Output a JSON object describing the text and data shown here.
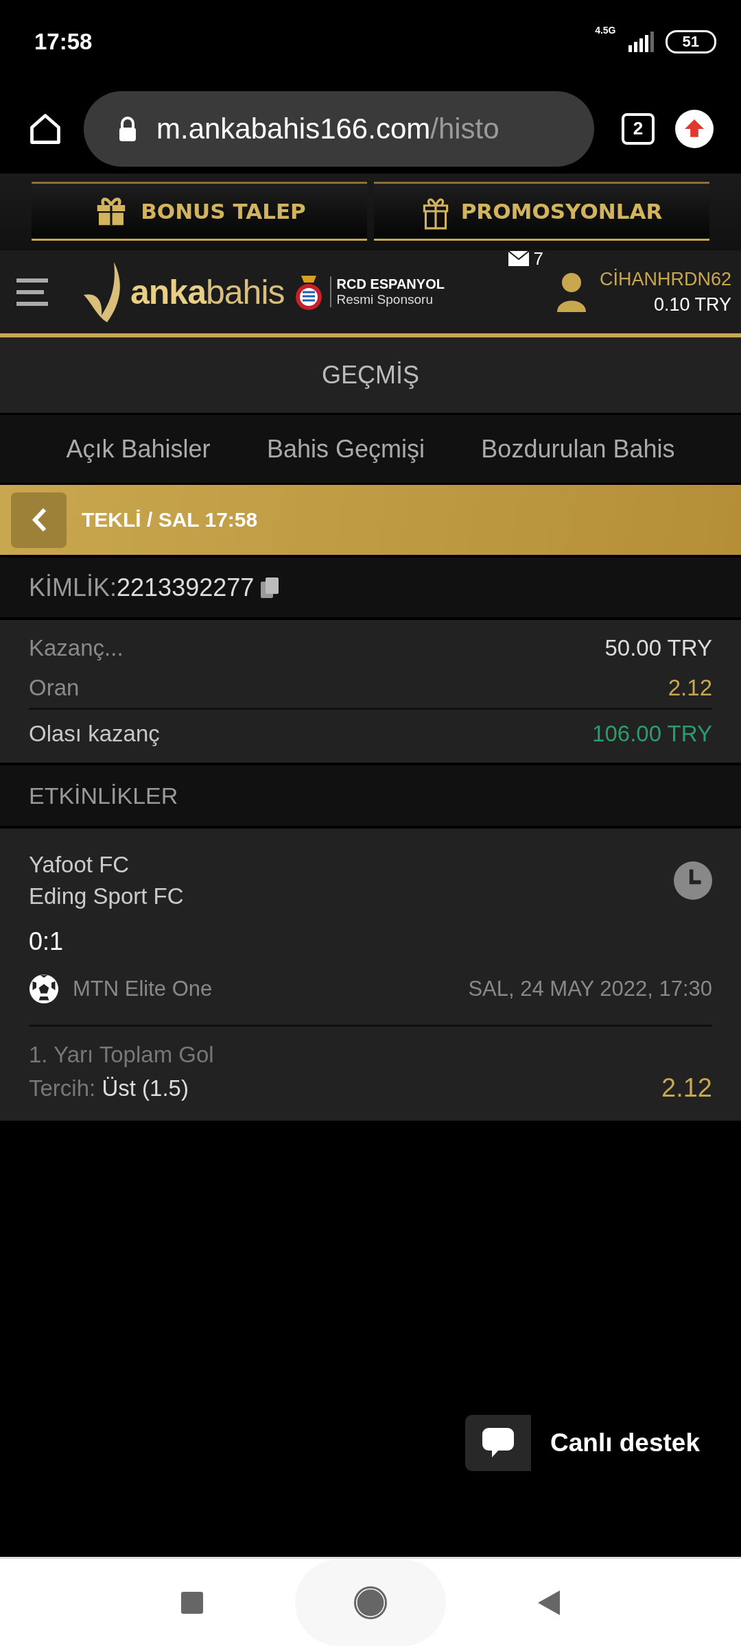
{
  "status_bar": {
    "time": "17:58",
    "network": "4.5G",
    "battery": "51"
  },
  "browser": {
    "url_host": "m.ankabahis166.com",
    "url_path": "/histo",
    "tab_count": "2"
  },
  "promo_buttons": [
    {
      "label": "BONUS TALEP",
      "kind": "filled"
    },
    {
      "label": "PROMOSYONLAR",
      "kind": "outline"
    }
  ],
  "header": {
    "logo": "**anka**bahis",
    "sponsor_name": "RCD ESPANYOL",
    "sponsor_role": "Resmi Sponsoru",
    "messages": "7",
    "username": "CİHANHRDN62",
    "balance": "0.10 TRY"
  },
  "page_title": "GEÇMİŞ",
  "tabs": [
    {
      "label": "Açık Bahisler",
      "selected": false
    },
    {
      "label": "Bahis Geçmişi",
      "selected": false
    },
    {
      "label": "Bozdurulan Bahis",
      "selected": false
    }
  ],
  "bet_header": {
    "title": "TEKLİ / SAL 17:58"
  },
  "bet_id": {
    "label": "KİMLİK:",
    "value": "2213392277"
  },
  "summary": [
    {
      "label": "Kazanç...",
      "value": "50.00 TRY",
      "kind": "plain"
    },
    {
      "label": "Oran",
      "value": "2.12",
      "kind": "odds"
    },
    {
      "label": "Olası kazanç",
      "value": "106.00 TRY",
      "kind": "win"
    }
  ],
  "events_title": "ETKİNLİKLER",
  "events": [
    {
      "home": "Yafoot FC",
      "away": "Eding Sport FC",
      "score": "0:1",
      "league": "MTN Elite One",
      "date": "SAL, 24 MAY 2022, 17:30",
      "market": "1. Yarı Toplam Gol",
      "choice_label": "Tercih:",
      "choice": "Üst (1.5)",
      "odds": "2.12"
    }
  ],
  "chat": {
    "label": "Canlı destek"
  }
}
